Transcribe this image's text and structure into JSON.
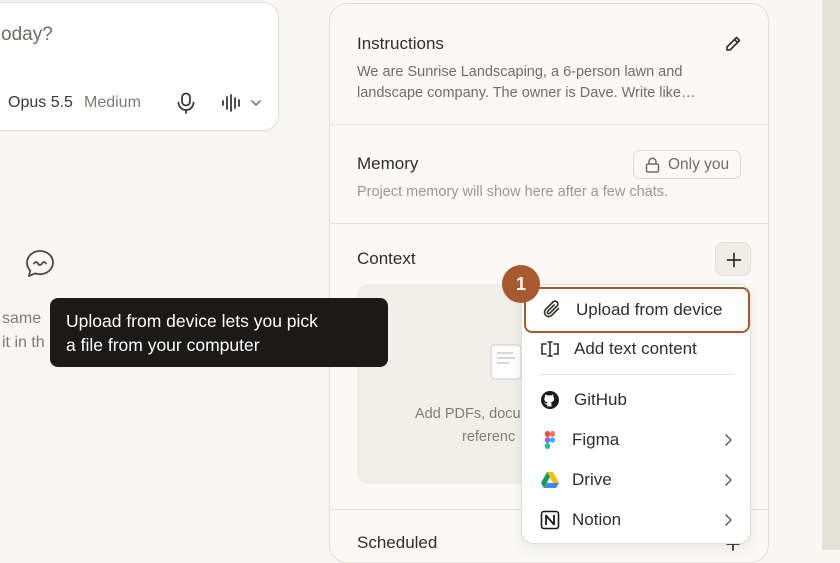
{
  "composer": {
    "placeholder_fragment": "oday?",
    "model": "Opus 5.5",
    "effort": "Medium"
  },
  "left": {
    "fragment_line1": "same",
    "fragment_line2": "it in th"
  },
  "tooltip": {
    "line1": "Upload from device lets you pick",
    "line2": "a file from your computer"
  },
  "instructions": {
    "title": "Instructions",
    "line1": "We are Sunrise Landscaping, a 6-person lawn and",
    "line2": "landscape company. The owner is Dave. Write like…"
  },
  "memory": {
    "title": "Memory",
    "visibility": "Only you",
    "description": "Project memory will show here after a few chats."
  },
  "context": {
    "title": "Context",
    "drop_line1": "Add PDFs, docu",
    "drop_line2": "referenc"
  },
  "scheduled": {
    "title": "Scheduled"
  },
  "menu": {
    "items": [
      {
        "label": "Upload from device",
        "icon": "paperclip-icon"
      },
      {
        "label": "Add text content",
        "icon": "text-cursor-icon"
      },
      {
        "label": "GitHub",
        "icon": "github-icon"
      },
      {
        "label": "Figma",
        "icon": "figma-icon"
      },
      {
        "label": "Drive",
        "icon": "google-drive-icon"
      },
      {
        "label": "Notion",
        "icon": "notion-icon"
      }
    ]
  },
  "step_badge": "1",
  "colors": {
    "accent": "#a85a2e",
    "tooltip_bg": "#1b1a18",
    "page_bg": "#f8f7f3"
  }
}
